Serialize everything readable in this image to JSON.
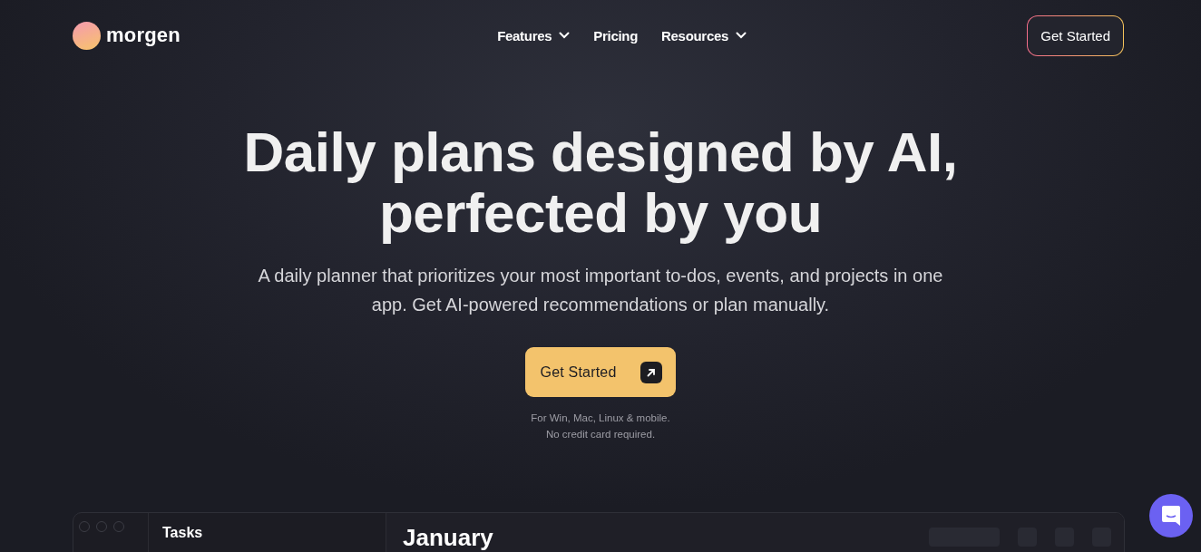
{
  "brand": {
    "name": "morgen"
  },
  "nav": [
    {
      "label": "Features",
      "dropdown": true
    },
    {
      "label": "Pricing",
      "dropdown": false
    },
    {
      "label": "Resources",
      "dropdown": true
    }
  ],
  "header_cta": "Get Started",
  "hero": {
    "title_lines": [
      "Daily plans designed by AI,",
      "perfected by you"
    ],
    "subtitle": "A daily planner that prioritizes your most important to-dos, events, and projects in one app. Get AI-powered recommendations or plan manually.",
    "cta": "Get Started",
    "notes": [
      "For Win, Mac, Linux & mobile.",
      "No credit card required."
    ]
  },
  "preview": {
    "sidebar_title": "Tasks",
    "month": "January"
  }
}
